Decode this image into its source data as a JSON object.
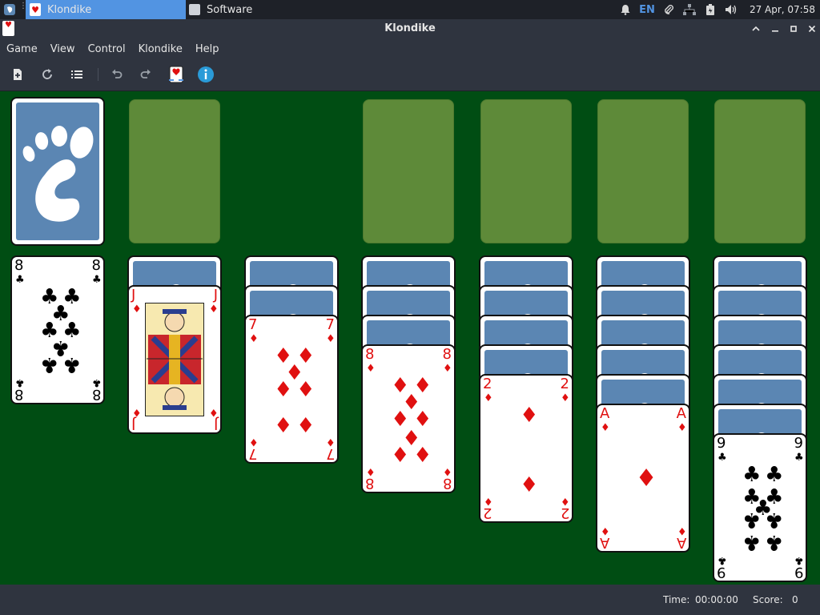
{
  "panel": {
    "tasks": [
      {
        "label": "Klondike",
        "icon": "solitaire-app-icon",
        "active": true
      },
      {
        "label": "Software",
        "icon": "software-bag-icon",
        "active": false
      }
    ],
    "tray": {
      "language": "EN",
      "clock": "27 Apr, 07:58",
      "icons": [
        "bell-icon",
        "language-indicator",
        "paperclip-icon",
        "network-icon",
        "battery-icon",
        "volume-icon"
      ]
    }
  },
  "window": {
    "title": "Klondike",
    "buttons": [
      "chevron-up-icon",
      "minimize-icon",
      "maximize-icon",
      "close-icon"
    ]
  },
  "menubar": [
    "Game",
    "View",
    "Control",
    "Klondike",
    "Help"
  ],
  "toolbar": [
    "new-game-icon",
    "restart-icon",
    "select-game-list-icon",
    "undo-icon",
    "redo-icon",
    "deal-card-icon",
    "info-icon"
  ],
  "colors": {
    "felt": "#004d13",
    "slot": "#5e8a39",
    "card_back": "#5b86b3",
    "red": "#e01010"
  },
  "board": {
    "stock": {
      "face_down": true
    },
    "waste": "empty",
    "foundations": [
      "empty",
      "empty",
      "empty",
      "empty"
    ],
    "tableau": [
      {
        "face_down": 0,
        "face_up": [
          {
            "rank": "8",
            "suit": "clubs"
          }
        ]
      },
      {
        "face_down": 1,
        "face_up": [
          {
            "rank": "J",
            "suit": "diamonds"
          }
        ]
      },
      {
        "face_down": 2,
        "face_up": [
          {
            "rank": "7",
            "suit": "diamonds"
          }
        ]
      },
      {
        "face_down": 3,
        "face_up": [
          {
            "rank": "8",
            "suit": "diamonds"
          }
        ]
      },
      {
        "face_down": 4,
        "face_up": [
          {
            "rank": "2",
            "suit": "diamonds"
          }
        ]
      },
      {
        "face_down": 5,
        "face_up": [
          {
            "rank": "A",
            "suit": "diamonds"
          }
        ]
      },
      {
        "face_down": 6,
        "face_up": [
          {
            "rank": "9",
            "suit": "clubs"
          }
        ]
      }
    ]
  },
  "status": {
    "time_label": "Time:",
    "time_value": "00:00:00",
    "score_label": "Score:",
    "score_value": "0"
  }
}
